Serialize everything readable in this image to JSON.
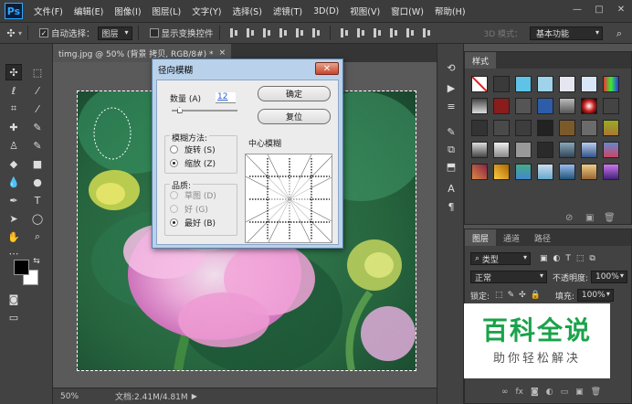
{
  "app": {
    "logo": "Ps"
  },
  "menu": [
    "文件(F)",
    "编辑(E)",
    "图像(I)",
    "图层(L)",
    "文字(Y)",
    "选择(S)",
    "滤镜(T)",
    "3D(D)",
    "视图(V)",
    "窗口(W)",
    "帮助(H)"
  ],
  "window_controls": {
    "minimize": "—",
    "maximize": "□",
    "close": "✕"
  },
  "options": {
    "auto_select_label": "自动选择：",
    "auto_select_checked": true,
    "auto_select_value": "图层",
    "show_transform_label": "显示变换控件",
    "show_transform_checked": false,
    "mode_3d_label": "3D 模式：",
    "workspace": "基本功能"
  },
  "document": {
    "tab_title": "timg.jpg @ 50% (背景 拷贝, RGB/8#) *",
    "tab_close": "×",
    "zoom": "50%",
    "doc_info": "文档:2.41M/4.81M"
  },
  "dialog": {
    "title": "径向模糊",
    "close": "✕",
    "amount_label": "数量 (A)",
    "amount_value": "12",
    "amount_fraction": 0.12,
    "ok_label": "确定",
    "reset_label": "复位",
    "method_label": "模糊方法:",
    "method_options": [
      "旋转 (S)",
      "缩放 (Z)"
    ],
    "method_selected": 1,
    "quality_label": "品质:",
    "quality_options": [
      "草图 (D)",
      "好 (G)",
      "最好 (B)"
    ],
    "quality_selected": 2,
    "center_label": "中心模糊"
  },
  "panels": {
    "styles_tab": "样式",
    "layers_tabs": [
      "图层",
      "通道",
      "路径"
    ],
    "kind_filter": "类型",
    "blend_mode": "正常",
    "opacity_label": "不透明度:",
    "opacity_value": "100%",
    "lock_label": "锁定:",
    "fill_label": "填充:",
    "fill_value": "100%"
  },
  "colors": {
    "foreground": "#000000",
    "background": "#ffffff",
    "accent": "#31a8ff"
  },
  "watermark": {
    "title": "百科全说",
    "subtitle": "助你轻松解决"
  }
}
